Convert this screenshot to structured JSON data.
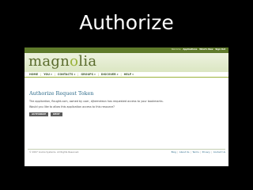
{
  "slide": {
    "title": "Authorize"
  },
  "topbar": {
    "welcome_text": "Welcome",
    "links": [
      "Applications",
      "What's New",
      "Sign Out"
    ]
  },
  "logo": {
    "text_dark": "magn",
    "text_accent": "o",
    "text_dark2": "lia"
  },
  "nav": {
    "items": [
      "HOME",
      "YOU ▾",
      "CONTACTS ▾",
      "GROUPS ▾",
      "DISCOVER ▾",
      "HELP ▾"
    ]
  },
  "content": {
    "title": "Authorize Request Token",
    "description": "The application, flought.com, owned by user, djhemeleon has requested access to your bookmarks.",
    "question": "Would you like to allow this application access to this resource?",
    "authorize_label": "AUTHORIZE",
    "deny_label": "DENY"
  },
  "footer": {
    "copyright": "© 2007 Gnolia Systems. All Rights Reserved.",
    "links": [
      "Blog",
      "About Us",
      "Terms",
      "Privacy",
      "Contact Us"
    ]
  },
  "colors": {
    "topbar": "#5f7a2b",
    "title_blue": "#2e6b8a",
    "logo_dark": "#5a6b2d",
    "logo_accent": "#9bb33c",
    "button": "#5c5c5c"
  }
}
